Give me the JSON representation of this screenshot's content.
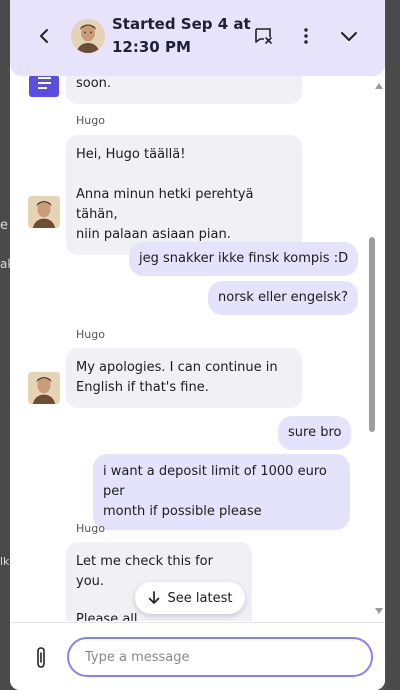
{
  "header": {
    "title": "Started Sep 4 at 12:30 PM"
  },
  "messages": {
    "partial_text": "soon.",
    "m1_sender": "Hugo",
    "m1_line1": "Hei, Hugo täällä!",
    "m1_line2": "Anna minun hetki perehtyä tähän,",
    "m1_line3": "niin palaan asiaan pian.",
    "u1": "jeg snakker ikke finsk kompis :D",
    "u2": "norsk eller engelsk?",
    "m2_sender": "Hugo",
    "m2_line1": "My apologies. I can continue in",
    "m2_line2": "English if that's fine.",
    "u3": "sure bro",
    "u4_line1": "i want a deposit limit of 1000 euro per",
    "u4_line2": "month if possible please",
    "m3_sender": "Hugo",
    "m3_line1": "Let me check this for you.",
    "m3_line2": "Please all"
  },
  "see_latest": {
    "label": "See latest"
  },
  "composer": {
    "placeholder": "Type a message"
  },
  "background": {
    "char1": "e",
    "char2": "ak",
    "char3": "lk"
  },
  "colors": {
    "header_bg": "#e6e3fb",
    "outgoing_bubble": "#e5e3fb",
    "incoming_bubble": "#f1f1f5",
    "accent": "#8b80f0",
    "bot_icon": "#5b4de0"
  }
}
